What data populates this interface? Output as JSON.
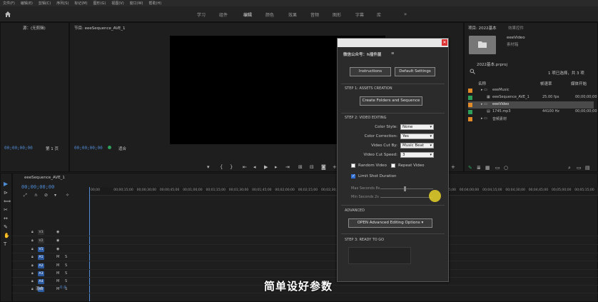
{
  "menubar": [
    "文件(F)",
    "编辑(E)",
    "剪辑(C)",
    "序列(S)",
    "标记(M)",
    "图形(G)",
    "视图(V)",
    "窗口(W)",
    "帮助(H)"
  ],
  "topnav": [
    "学习",
    "组件",
    "编辑",
    "颜色",
    "效果",
    "音频",
    "图形",
    "字幕",
    "库"
  ],
  "source_panel": {
    "title": "源：(无剪辑)",
    "timecode": "00;00;00;00",
    "page": "第 1 页"
  },
  "program_panel": {
    "title": "节目: eeeSequence_AVE_1",
    "timecode": "00;00;00;00",
    "fit": "适合"
  },
  "project_panel": {
    "tab": "项目: 2022基本",
    "tab2": "效果控件",
    "bin_name": "eeeVideo",
    "bin_sub": "素材箱",
    "file": "2022基本.prproj",
    "selection": "1 项已选择，共 3 项",
    "columns": [
      "名称",
      "帧速率",
      "媒体开始"
    ],
    "rows": [
      {
        "name": "eeeMusic",
        "rate": "",
        "start": "",
        "color": "#e08a2a"
      },
      {
        "name": "eeeSequence_AVE_1",
        "rate": "25.00 fps",
        "start": "00;00;00;00",
        "color": "#2ea05a"
      },
      {
        "name": "eeeVideo",
        "rate": "",
        "start": "",
        "color": "#e08a2a"
      },
      {
        "name": "1745.mp3",
        "rate": "44100 Hz",
        "start": "00;00;00;00",
        "color": "#2ea05a"
      },
      {
        "name": "音频素材",
        "rate": "",
        "start": "",
        "color": "#e08a2a"
      }
    ]
  },
  "timeline": {
    "title": "eeeSequence_AVE_1",
    "timecode": "00;00;00;00",
    "ruler": [
      "00;00",
      "00;00;15;00",
      "00;00;30;00",
      "00;00;45;00",
      "00;01;00;00",
      "00;01;15;00",
      "00;01;30;00",
      "00;01;45;00",
      "00;02;00;00",
      "00;02;15;00",
      "00;02;30;00",
      "00;02;45;00",
      "00;03;00;00",
      "00;03;15;00",
      "00;03;30;00",
      "00;03;45;00",
      "00;04;00;00",
      "00;04;15;00",
      "00;04;30;00",
      "00;04;45;00",
      "00;05;00;00",
      "00;05;15;00"
    ],
    "tracks": [
      {
        "name": "V3",
        "type": "video"
      },
      {
        "name": "V2",
        "type": "video"
      },
      {
        "name": "V1",
        "type": "video"
      },
      {
        "name": "A1",
        "type": "audio"
      },
      {
        "name": "A2",
        "type": "audio"
      },
      {
        "name": "A3",
        "type": "audio"
      },
      {
        "name": "A4",
        "type": "audio"
      },
      {
        "name": "A5",
        "type": "audio"
      }
    ],
    "master": "混合",
    "master_val": "0.0"
  },
  "dialog": {
    "title": "微信公众号：h插件屋",
    "instructions": "Instructions",
    "default_settings": "Default Settings",
    "step1": "STEP 1: ASSETS CREATION",
    "create_btn": "Create Folders and Sequence",
    "step2": "STEP 2: VIDEO EDITING",
    "fields": [
      {
        "label": "Color Style:",
        "value": "None"
      },
      {
        "label": "Color Correction:",
        "value": "Yes"
      },
      {
        "label": "Video Cut By:",
        "value": "Music Beat"
      },
      {
        "label": "Video Cut Speed:",
        "value": "3"
      }
    ],
    "random_video": "Random Video",
    "repeat_video": "Repeat Video",
    "limit_shot": "Limit Shot Duration",
    "max_seconds": "Max Seconds 8s",
    "min_seconds": "Min Seconds 2s",
    "advanced": "ADVANCED",
    "open_advanced": "OPEN Advanced Editing Options",
    "step3": "STEP 3: READY TO GO"
  },
  "subtitle": "简单设好参数"
}
